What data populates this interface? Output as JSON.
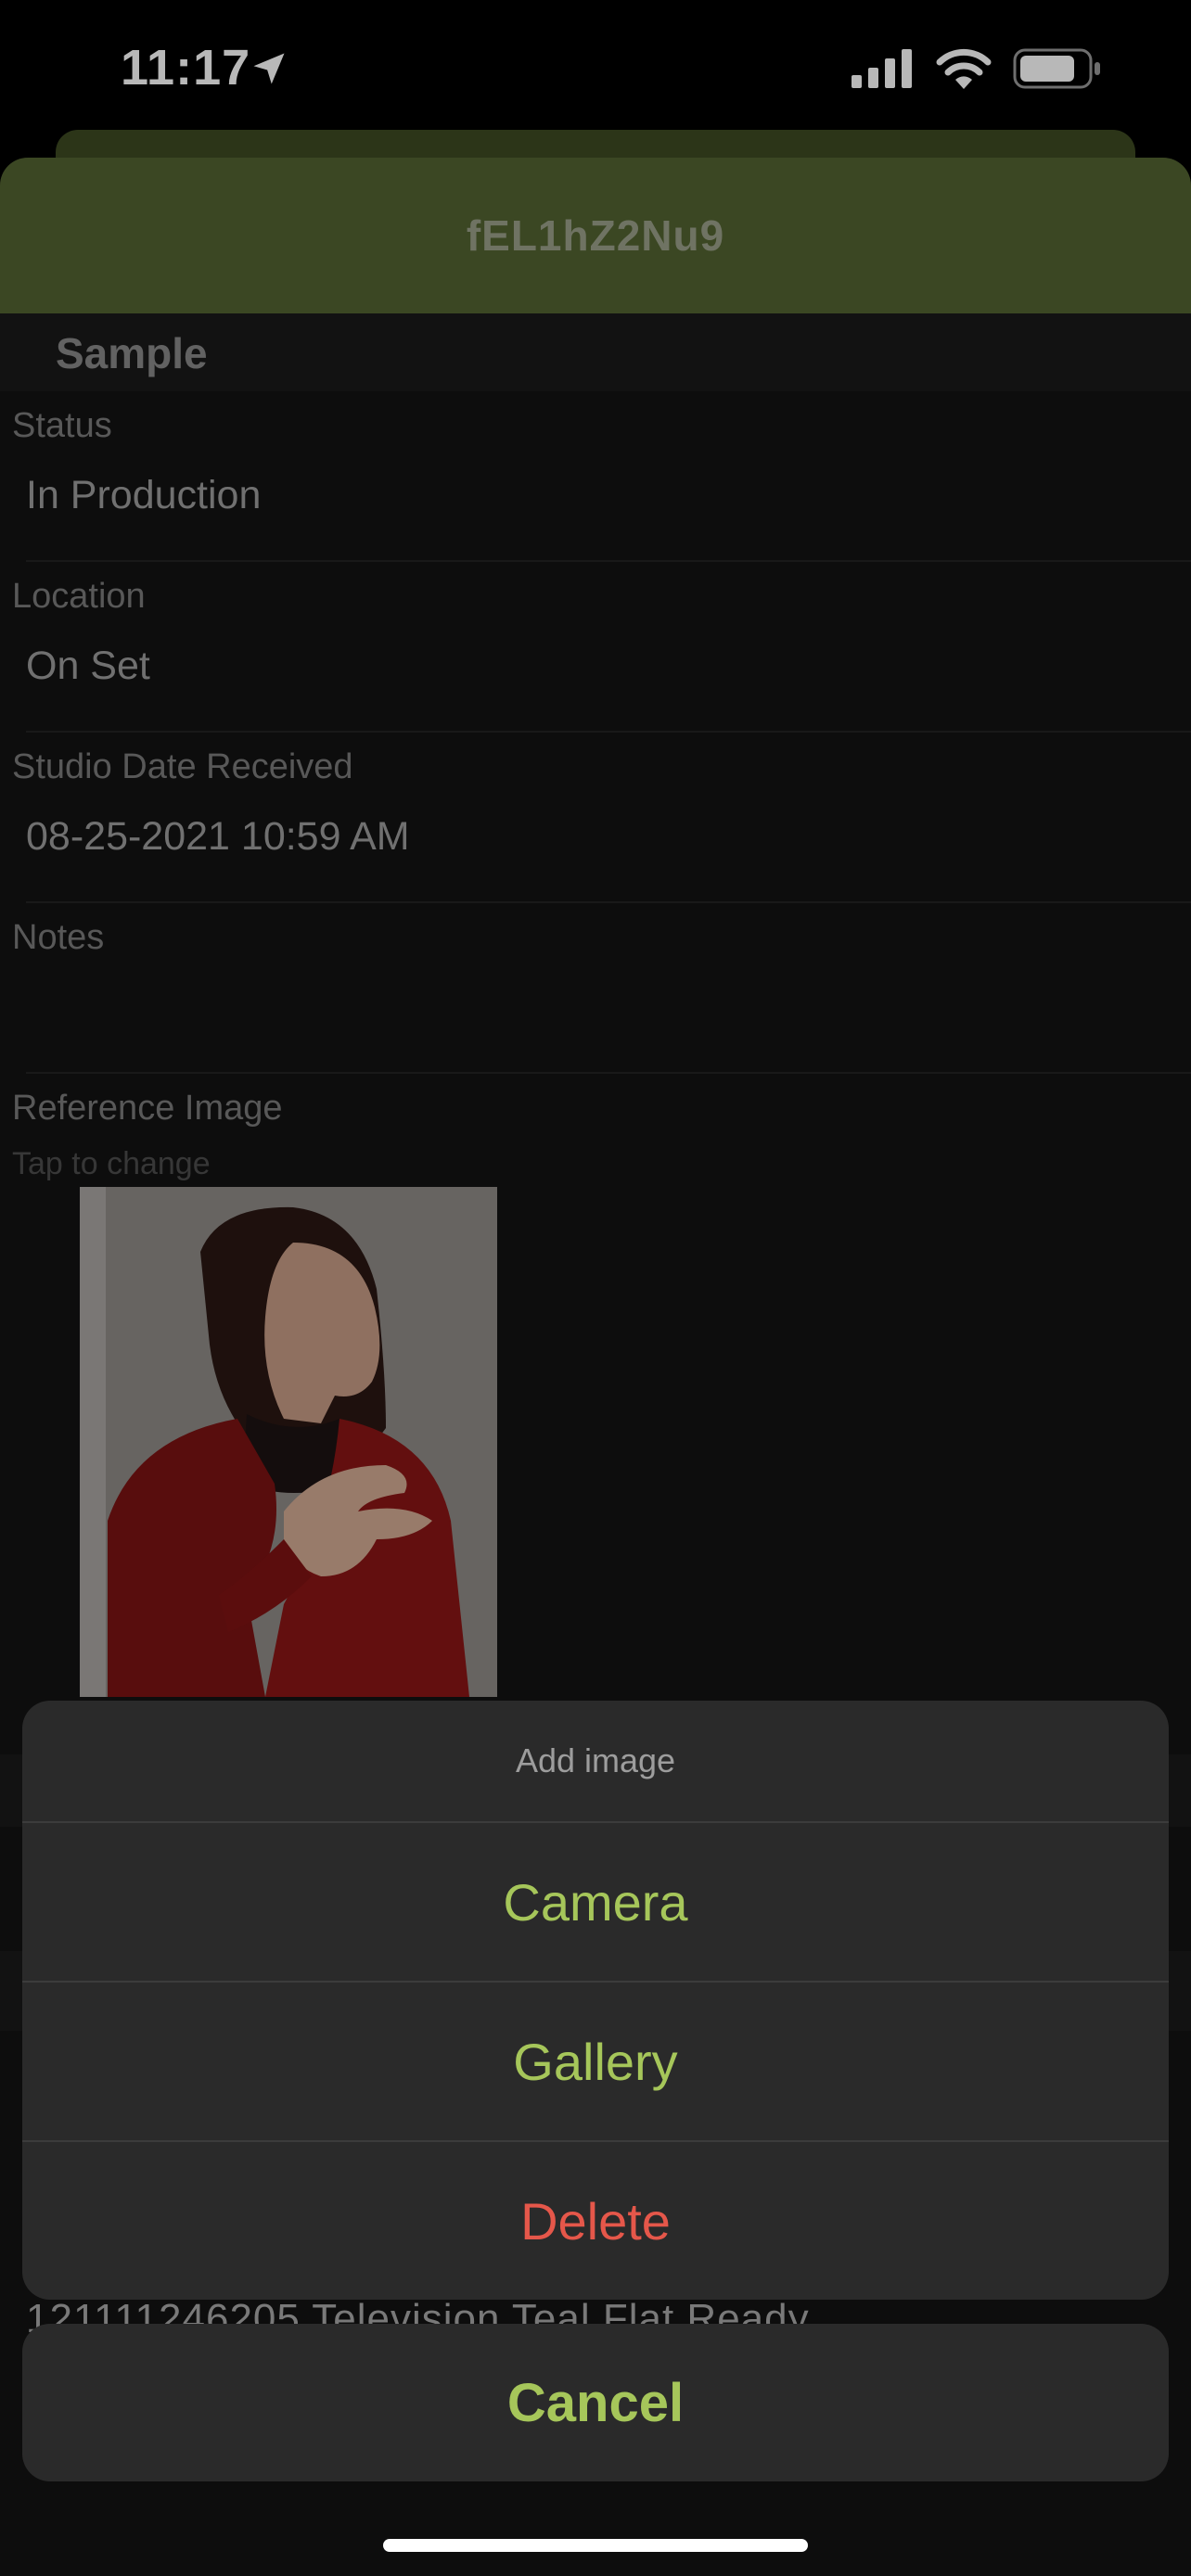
{
  "status_bar": {
    "time": "11:17",
    "icons": [
      "location-arrow-icon",
      "signal-icon",
      "wifi-icon",
      "battery-icon"
    ]
  },
  "sheet": {
    "title": "fEL1hZ2Nu9",
    "section_title": "Sample",
    "fields": [
      {
        "label": "Status",
        "value": "In Production"
      },
      {
        "label": "Location",
        "value": "On Set"
      },
      {
        "label": "Studio Date Received",
        "value": "08-25-2021 10:59 AM"
      },
      {
        "label": "Notes",
        "value": ""
      }
    ],
    "reference_image": {
      "label": "Reference Image",
      "hint": "Tap to change"
    },
    "peek_row_text": "121111246205  Television  Teal  Flat    Ready"
  },
  "action_sheet": {
    "title": "Add image",
    "options": [
      {
        "label": "Camera",
        "color": "#a6c65a"
      },
      {
        "label": "Gallery",
        "color": "#a6c65a"
      },
      {
        "label": "Delete",
        "color": "#e5574a"
      }
    ],
    "cancel_label": "Cancel",
    "cancel_color": "#a6c65a"
  },
  "colors": {
    "header_green": "#536331",
    "accent_green": "#a6c65a",
    "destructive_red": "#e5574a"
  }
}
